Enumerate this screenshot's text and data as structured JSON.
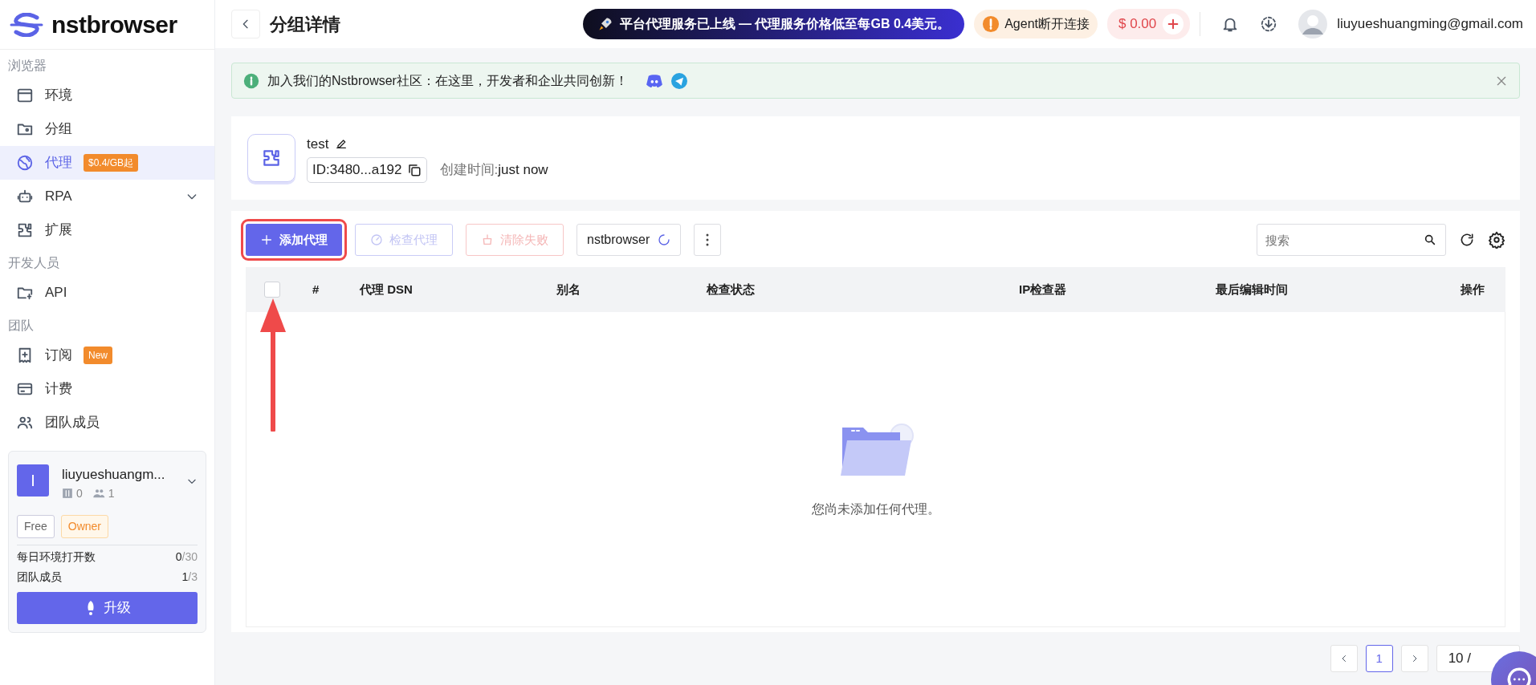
{
  "logo": "nstbrowser",
  "sidebar": {
    "sections": [
      {
        "title": "浏览器",
        "items": [
          {
            "label": "环境",
            "selected": false
          },
          {
            "label": "分组",
            "selected": false
          },
          {
            "label": "代理",
            "selected": true,
            "badge": "$0.4/GB起"
          },
          {
            "label": "RPA",
            "selected": false,
            "expanded": false
          },
          {
            "label": "扩展",
            "selected": false
          }
        ]
      },
      {
        "title": "开发人员",
        "items": [
          {
            "label": "API",
            "selected": false
          }
        ]
      },
      {
        "title": "团队",
        "items": [
          {
            "label": "订阅",
            "selected": false,
            "badge": "New"
          },
          {
            "label": "计费",
            "selected": false
          },
          {
            "label": "团队成员",
            "selected": false
          }
        ]
      }
    ]
  },
  "team": {
    "avatar": "I",
    "name": "liuyueshuangm...",
    "profiles": "0",
    "members": "1",
    "tags": [
      "Free",
      "Owner"
    ],
    "stats": [
      {
        "label": "每日环境打开数",
        "used": "0",
        "limit": "/30"
      },
      {
        "label": "团队成员",
        "used": "1",
        "limit": "/3"
      }
    ],
    "upgrade": "升级"
  },
  "topbar": {
    "title": "分组详情",
    "promo": "平台代理服务已上线 — 代理服务价格低至每GB 0.4美元。",
    "agent": "Agent断开连接",
    "balance": "$ 0.00",
    "email": "liuyueshuangming@gmail.com"
  },
  "alert": {
    "text": "加入我们的Nstbrowser社区：在这里，开发者和企业共同创新！"
  },
  "group": {
    "name": "test",
    "id": "ID:3480...a192",
    "created_label": "创建时间:",
    "created": "just now"
  },
  "toolbar": {
    "buttons": [
      {
        "label": "添加代理",
        "kind": "primary",
        "disabled": false
      },
      {
        "label": "检查代理",
        "kind": "check",
        "disabled": true
      },
      {
        "label": "清除失败",
        "kind": "danger",
        "disabled": true
      }
    ],
    "browser": "nstbrowser",
    "search": {
      "placeholder": "搜索"
    }
  },
  "table": {
    "select_all": {
      "checked": false
    },
    "columns": [
      "#",
      "代理 DSN",
      "别名",
      "检查状态",
      "IP检查器",
      "最后编辑时间",
      "操作"
    ],
    "empty": "您尚未添加任何代理。"
  },
  "pagination": {
    "pages": [
      {
        "label": "1",
        "selected": true
      }
    ],
    "page_size": "10 /"
  }
}
